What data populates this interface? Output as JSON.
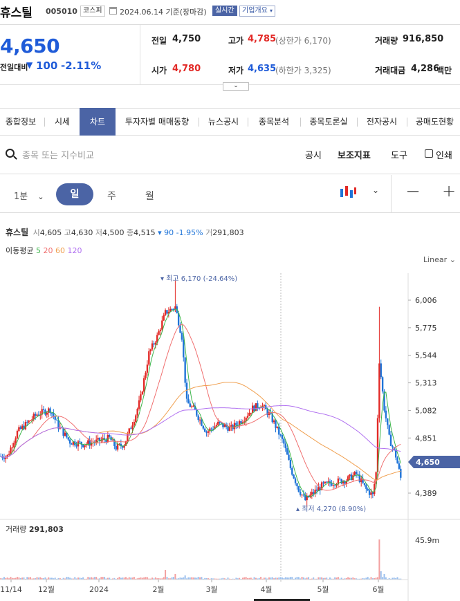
{
  "header": {
    "name": "휴스틸",
    "code": "005010",
    "market": "코스피",
    "date_text": "2024.06.14 기준(장마감)",
    "realtime": "실시간",
    "company_info": "기업개요"
  },
  "quote": {
    "price": "4,650",
    "change_label": "전일대비",
    "change_arrow": "▼",
    "change": "100",
    "change_pct": "-2.11%",
    "prev_label": "전일",
    "prev": "4,750",
    "high_label": "고가",
    "high": "4,785",
    "upper_limit": "(상한가 6,170)",
    "volume_label": "거래량",
    "volume": "916,850",
    "open_label": "시가",
    "open": "4,780",
    "low_label": "저가",
    "low": "4,635",
    "lower_limit": "(하한가 3,325)",
    "amount_label": "거래대금",
    "amount": "4,286",
    "amount_unit": "백만"
  },
  "tabs": [
    "종합정보",
    "시세",
    "차트",
    "투자자별 매매동향",
    "뉴스공시",
    "종목분석",
    "종목토론실",
    "전자공시",
    "공매도현황"
  ],
  "toolbar": {
    "search_placeholder": "종목 또는 지수비교",
    "notice": "공시",
    "indicators": "보조지표",
    "tools": "도구",
    "print": "인쇄"
  },
  "periods": {
    "minute": "1분",
    "day": "일",
    "week": "주",
    "month": "월"
  },
  "zoom": {
    "minus": "—",
    "plus": "+"
  },
  "legend": {
    "name": "휴스틸",
    "open_label": "시",
    "open": "4,605",
    "high_label": "고",
    "high": "4,630",
    "low_label": "저",
    "low": "4,500",
    "close_label": "종",
    "close": "4,515",
    "change": "▾ 90 -1.95%",
    "vol_label": "거",
    "vol": "291,803"
  },
  "ma_legend": {
    "title": "이동평균",
    "ma5": "5",
    "ma20": "20",
    "ma60": "60",
    "ma120": "120"
  },
  "scale_mode": "Linear",
  "colors": {
    "up": "#e22926",
    "down": "#1f74d8",
    "ma5": "#3bb54a",
    "ma20": "#f07070",
    "ma60": "#f0a050",
    "ma120": "#b070f0",
    "price_tag": "#4b64a5"
  },
  "chart_data": {
    "type": "candlestick",
    "y_ticks": [
      "6,006",
      "5,775",
      "5,544",
      "5,313",
      "5,082",
      "4,851",
      "4,389"
    ],
    "current_price_tag": "4,650",
    "max_annotation": "최고 6,170 (-24.64%)",
    "min_annotation": "최저 4,270 (8.90%)",
    "x_ticks": [
      "11/14",
      "12월",
      "2024",
      "2월",
      "3월",
      "4월",
      "5월",
      "6월"
    ],
    "volume_label": "거래량",
    "volume_value": "291,803",
    "volume_tick": "45.9m",
    "series": [
      {
        "name": "일봉",
        "keypoints": [
          [
            0,
            4700
          ],
          [
            4,
            4700
          ],
          [
            10,
            4900
          ],
          [
            22,
            5050
          ],
          [
            30,
            5090
          ],
          [
            35,
            4950
          ],
          [
            42,
            4820
          ],
          [
            50,
            4800
          ],
          [
            58,
            4820
          ],
          [
            66,
            4850
          ],
          [
            70,
            4770
          ],
          [
            75,
            4800
          ],
          [
            82,
            5050
          ],
          [
            85,
            5190
          ],
          [
            90,
            5560
          ],
          [
            95,
            5700
          ],
          [
            100,
            5900
          ],
          [
            106,
            5950
          ],
          [
            110,
            5700
          ],
          [
            113,
            5150
          ],
          [
            118,
            5080
          ],
          [
            125,
            4900
          ],
          [
            132,
            4970
          ],
          [
            140,
            4930
          ],
          [
            148,
            5020
          ],
          [
            153,
            5100
          ],
          [
            158,
            5130
          ],
          [
            163,
            5050
          ],
          [
            166,
            4980
          ],
          [
            172,
            4800
          ],
          [
            176,
            4600
          ],
          [
            181,
            4420
          ],
          [
            185,
            4330
          ],
          [
            189,
            4380
          ],
          [
            195,
            4450
          ],
          [
            202,
            4480
          ],
          [
            210,
            4500
          ],
          [
            216,
            4550
          ],
          [
            222,
            4420
          ],
          [
            226,
            4370
          ],
          [
            228,
            4560
          ],
          [
            230,
            5500
          ],
          [
            233,
            5100
          ],
          [
            236,
            4850
          ],
          [
            240,
            4700
          ],
          [
            243,
            4515
          ]
        ]
      },
      {
        "name": "5",
        "values": []
      },
      {
        "name": "20",
        "values": []
      },
      {
        "name": "60",
        "values": []
      },
      {
        "name": "120",
        "values": []
      }
    ]
  }
}
